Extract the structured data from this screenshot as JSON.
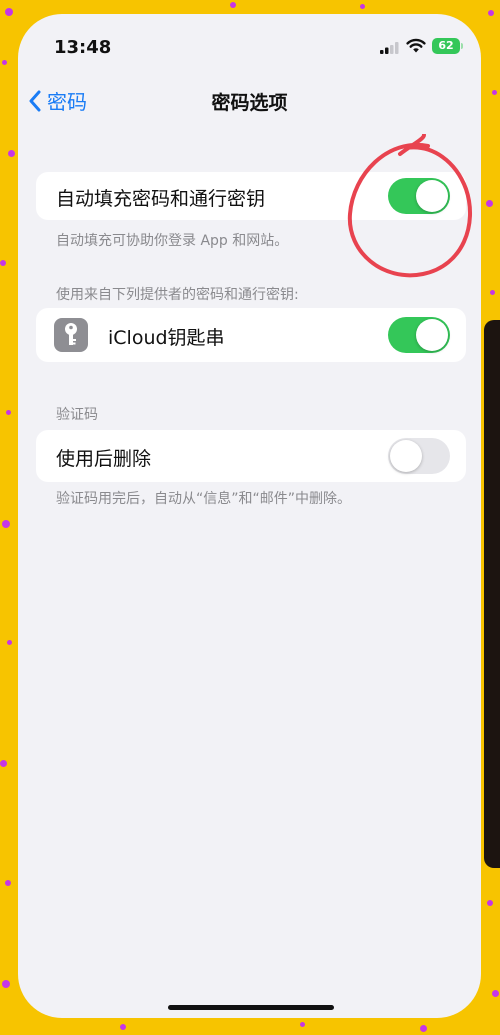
{
  "status_bar": {
    "time": "13:48",
    "battery": "62"
  },
  "nav": {
    "back_label": "密码",
    "title": "密码选项"
  },
  "autofill": {
    "label": "自动填充密码和通行密钥",
    "enabled": true,
    "footer": "自动填充可协助你登录 App 和网站。"
  },
  "providers": {
    "header": "使用来自下列提供者的密码和通行密钥:",
    "items": [
      {
        "label": "iCloud钥匙串",
        "enabled": true
      }
    ]
  },
  "verification": {
    "header": "验证码",
    "delete_label": "使用后删除",
    "enabled": false,
    "footer": "验证码用完后，自动从“信息”和“邮件”中删除。"
  },
  "colors": {
    "accent": "#1a7cf5",
    "toggle_on": "#34c759",
    "frame": "#f7c400",
    "dots": "#c636e6",
    "annotation": "#e8434f"
  }
}
